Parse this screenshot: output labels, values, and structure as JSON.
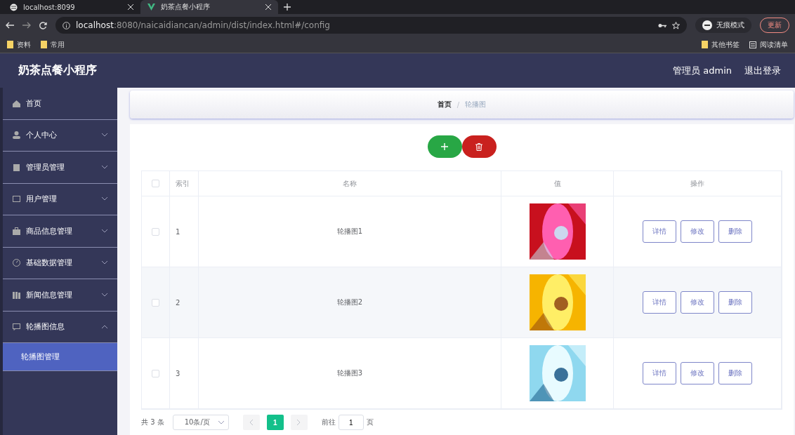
{
  "browser": {
    "tabs": [
      {
        "title": "localhost:8099",
        "selected": false
      },
      {
        "title": "奶茶点餐小程序",
        "selected": true
      }
    ],
    "address": {
      "host": "localhost",
      "rest": ":8080/naicaidiancan/admin/dist/index.html#/config"
    },
    "incognito": "无痕模式",
    "update": "更新",
    "bookmarks": [
      "资料",
      "常用"
    ],
    "other_bookmarks": "其他书签",
    "reading_list": "阅读清单"
  },
  "header": {
    "title": "奶茶点餐小程序",
    "user": "管理员 admin",
    "logout": "退出登录"
  },
  "sidebar": {
    "items": [
      {
        "label": "首页"
      },
      {
        "label": "个人中心",
        "expanded": false
      },
      {
        "label": "管理员管理",
        "expanded": false
      },
      {
        "label": "用户管理",
        "expanded": false
      },
      {
        "label": "商品信息管理",
        "expanded": false
      },
      {
        "label": "基础数据管理",
        "expanded": false
      },
      {
        "label": "新闻信息管理",
        "expanded": false
      },
      {
        "label": "轮播图信息",
        "expanded": true,
        "children": [
          {
            "label": "轮播图管理",
            "selected": true
          }
        ]
      }
    ]
  },
  "breadcrumb": {
    "items": [
      "首页",
      "轮播图"
    ],
    "separator": "/"
  },
  "table": {
    "header_checked": false,
    "columns": [
      "索引",
      "名称",
      "值",
      "操作"
    ],
    "rows": [
      {
        "index": "1",
        "name": "轮播图1",
        "checked": false,
        "actions": [
          "详情",
          "修改",
          "删除"
        ]
      },
      {
        "index": "2",
        "name": "轮播图2",
        "checked": false,
        "actions": [
          "详情",
          "修改",
          "删除"
        ]
      },
      {
        "index": "3",
        "name": "轮播图3",
        "checked": false,
        "actions": [
          "详情",
          "修改",
          "删除"
        ]
      }
    ]
  },
  "pagination": {
    "total": "共 3 条",
    "page_size": "10条/页",
    "pages": [
      {
        "label": "1",
        "selected": true
      }
    ],
    "goto_label": "前往",
    "goto_value": "1",
    "page_suffix": "页"
  }
}
